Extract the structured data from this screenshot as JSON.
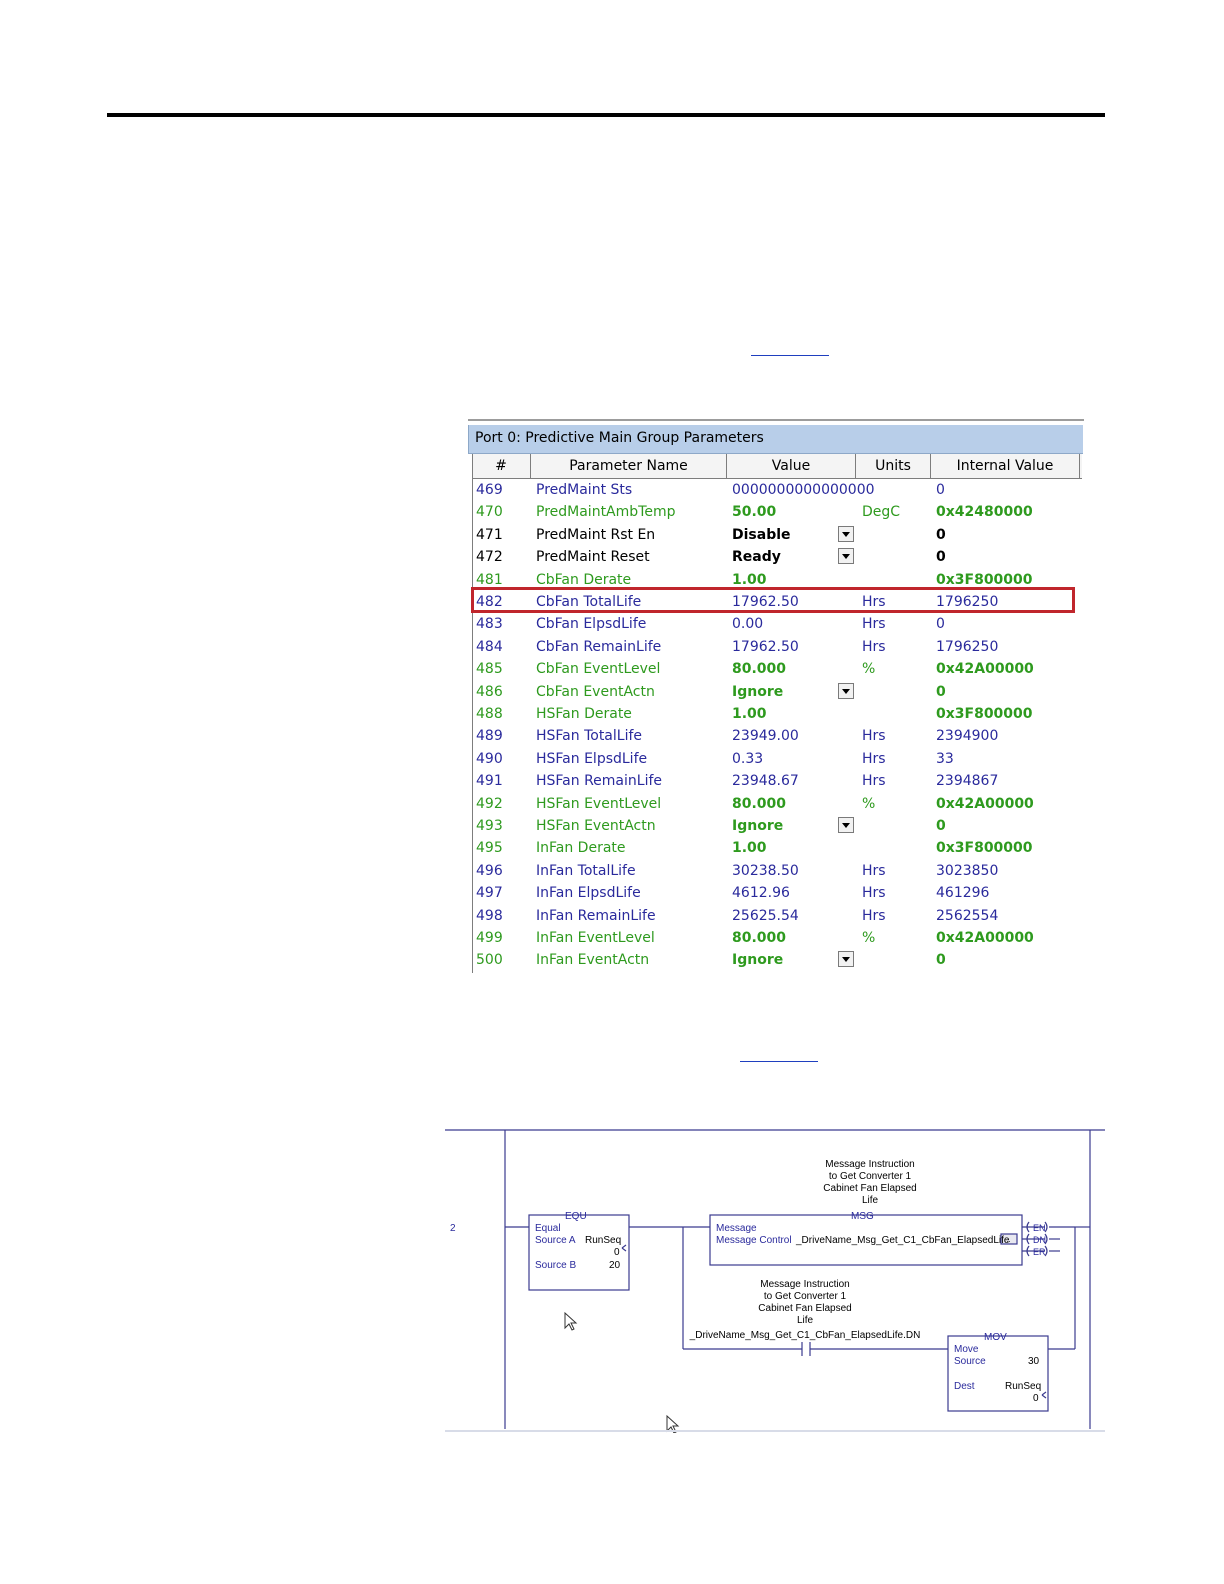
{
  "param_table": {
    "title": "Port 0: Predictive Main Group Parameters",
    "columns": [
      "#",
      "Parameter Name",
      "Value",
      "Units",
      "Internal Value"
    ],
    "rows": [
      {
        "num": "469",
        "name": "PredMaint Sts",
        "value": "0000000000000000",
        "units": "",
        "internal": "0",
        "color": "blue",
        "bold": false,
        "dropdown": false
      },
      {
        "num": "470",
        "name": "PredMaintAmbTemp",
        "value": "50.00",
        "units": "DegC",
        "internal": "0x42480000",
        "color": "green",
        "bold": true,
        "dropdown": false
      },
      {
        "num": "471",
        "name": "PredMaint Rst En",
        "value": "Disable",
        "units": "",
        "internal": "0",
        "color": "black",
        "bold": true,
        "dropdown": true
      },
      {
        "num": "472",
        "name": "PredMaint Reset",
        "value": "Ready",
        "units": "",
        "internal": "0",
        "color": "black",
        "bold": true,
        "dropdown": true
      },
      {
        "num": "481",
        "name": "CbFan Derate",
        "value": "1.00",
        "units": "",
        "internal": "0x3F800000",
        "color": "green",
        "bold": true,
        "dropdown": false
      },
      {
        "num": "482",
        "name": "CbFan TotalLife",
        "value": "17962.50",
        "units": "Hrs",
        "internal": "1796250",
        "color": "blue",
        "bold": false,
        "dropdown": false
      },
      {
        "num": "483",
        "name": "CbFan ElpsdLife",
        "value": "0.00",
        "units": "Hrs",
        "internal": "0",
        "color": "blue",
        "bold": false,
        "dropdown": false
      },
      {
        "num": "484",
        "name": "CbFan RemainLife",
        "value": "17962.50",
        "units": "Hrs",
        "internal": "1796250",
        "color": "blue",
        "bold": false,
        "dropdown": false
      },
      {
        "num": "485",
        "name": "CbFan EventLevel",
        "value": "80.000",
        "units": "%",
        "internal": "0x42A00000",
        "color": "green",
        "bold": true,
        "dropdown": false
      },
      {
        "num": "486",
        "name": "CbFan EventActn",
        "value": "Ignore",
        "units": "",
        "internal": "0",
        "color": "green",
        "bold": true,
        "dropdown": true
      },
      {
        "num": "488",
        "name": "HSFan Derate",
        "value": "1.00",
        "units": "",
        "internal": "0x3F800000",
        "color": "green",
        "bold": true,
        "dropdown": false
      },
      {
        "num": "489",
        "name": "HSFan TotalLife",
        "value": "23949.00",
        "units": "Hrs",
        "internal": "2394900",
        "color": "blue",
        "bold": false,
        "dropdown": false
      },
      {
        "num": "490",
        "name": "HSFan ElpsdLife",
        "value": "0.33",
        "units": "Hrs",
        "internal": "33",
        "color": "blue",
        "bold": false,
        "dropdown": false
      },
      {
        "num": "491",
        "name": "HSFan RemainLife",
        "value": "23948.67",
        "units": "Hrs",
        "internal": "2394867",
        "color": "blue",
        "bold": false,
        "dropdown": false
      },
      {
        "num": "492",
        "name": "HSFan EventLevel",
        "value": "80.000",
        "units": "%",
        "internal": "0x42A00000",
        "color": "green",
        "bold": true,
        "dropdown": false
      },
      {
        "num": "493",
        "name": "HSFan EventActn",
        "value": "Ignore",
        "units": "",
        "internal": "0",
        "color": "green",
        "bold": true,
        "dropdown": true
      },
      {
        "num": "495",
        "name": "InFan Derate",
        "value": "1.00",
        "units": "",
        "internal": "0x3F800000",
        "color": "green",
        "bold": true,
        "dropdown": false
      },
      {
        "num": "496",
        "name": "InFan TotalLife",
        "value": "30238.50",
        "units": "Hrs",
        "internal": "3023850",
        "color": "blue",
        "bold": false,
        "dropdown": false
      },
      {
        "num": "497",
        "name": "InFan ElpsdLife",
        "value": "4612.96",
        "units": "Hrs",
        "internal": "461296",
        "color": "blue",
        "bold": false,
        "dropdown": false
      },
      {
        "num": "498",
        "name": "InFan RemainLife",
        "value": "25625.54",
        "units": "Hrs",
        "internal": "2562554",
        "color": "blue",
        "bold": false,
        "dropdown": false
      },
      {
        "num": "499",
        "name": "InFan EventLevel",
        "value": "80.000",
        "units": "%",
        "internal": "0x42A00000",
        "color": "green",
        "bold": true,
        "dropdown": false
      },
      {
        "num": "500",
        "name": "InFan EventActn",
        "value": "Ignore",
        "units": "",
        "internal": "0",
        "color": "green",
        "bold": true,
        "dropdown": true
      }
    ],
    "highlighted_row": "482",
    "colors": {
      "blue": "#2a2a9c",
      "green": "#2e9a1e",
      "highlight": "#c0262c",
      "title_bg": "#b8cee9"
    }
  },
  "ladder": {
    "rung_number": "2",
    "equ": {
      "tag": "EQU",
      "title": "Equal",
      "source_a_label": "Source A",
      "source_a_tag": "RunSeq",
      "source_a_value": "0",
      "source_b_label": "Source B",
      "source_b_value": "20"
    },
    "msg": {
      "tag": "MSG",
      "comment": [
        "Message Instruction",
        "to Get Converter 1",
        "Cabinet Fan Elapsed",
        "Life"
      ],
      "title": "Message",
      "control_label": "Message Control",
      "control_tag": "_DriveName_Msg_Get_C1_CbFan_ElapsedLife",
      "browse_label": "...",
      "outputs": [
        "EN",
        "DN",
        "ER"
      ]
    },
    "xic": {
      "comment": [
        "Message Instruction",
        "to Get Converter 1",
        "Cabinet Fan Elapsed",
        "Life"
      ],
      "tag": "_DriveName_Msg_Get_C1_CbFan_ElapsedLife.DN"
    },
    "mov": {
      "tag": "MOV",
      "title": "Move",
      "source_label": "Source",
      "source_value": "30",
      "dest_label": "Dest",
      "dest_tag": "RunSeq",
      "dest_value": "0"
    },
    "icons": [
      "mouse-pointer-icon"
    ],
    "colors": {
      "wire": "#3b3b8f",
      "text": "#2a2a9c"
    }
  }
}
